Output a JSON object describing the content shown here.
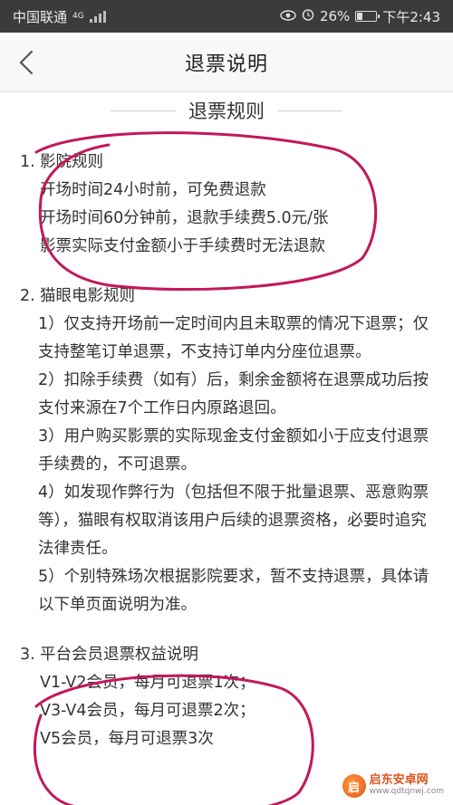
{
  "status_bar": {
    "carrier": "中国联通",
    "network": "4G",
    "battery": "26%",
    "battery_level": 0.26,
    "time": "下午2:43"
  },
  "nav": {
    "title": "退票说明"
  },
  "section": {
    "title": "退票规则"
  },
  "rules": [
    {
      "number": "1.",
      "title": "影院规则",
      "lines": [
        "开场时间24小时前，可免费退款",
        "开场时间60分钟前，退款手续费5.0元/张",
        "影票实际支付金额小于手续费时无法退款"
      ]
    },
    {
      "number": "2.",
      "title": "猫眼电影规则",
      "lines": [
        "1）仅支持开场前一定时间内且未取票的情况下退票；仅支持整笔订单退票，不支持订单内分座位退票。",
        "2）扣除手续费（如有）后，剩余金额将在退票成功后按支付来源在7个工作日内原路退回。",
        "3）用户购买影票的实际现金支付金额如小于应支付退票手续费的，不可退票。",
        "4）如发现作弊行为（包括但不限于批量退票、恶意购票等），猫眼有权取消该用户后续的退票资格，必要时追究法律责任。",
        "5）个别特殊场次根据影院要求，暂不支持退票，具体请以下单页面说明为准。"
      ]
    },
    {
      "number": "3.",
      "title": "平台会员退票权益说明",
      "lines": [
        "V1-V2会员，每月可退票1次；",
        "V3-V4会员，每月可退票2次；",
        "V5会员，每月可退票3次"
      ]
    }
  ],
  "watermark": {
    "name": "启东安卓网",
    "url": "www.qdtqnwj.com"
  },
  "colors": {
    "annotation": "#c2185b",
    "status_bar_bg": "#3b3b3b",
    "nav_bg": "#f8f8f8",
    "text": "#333333"
  }
}
